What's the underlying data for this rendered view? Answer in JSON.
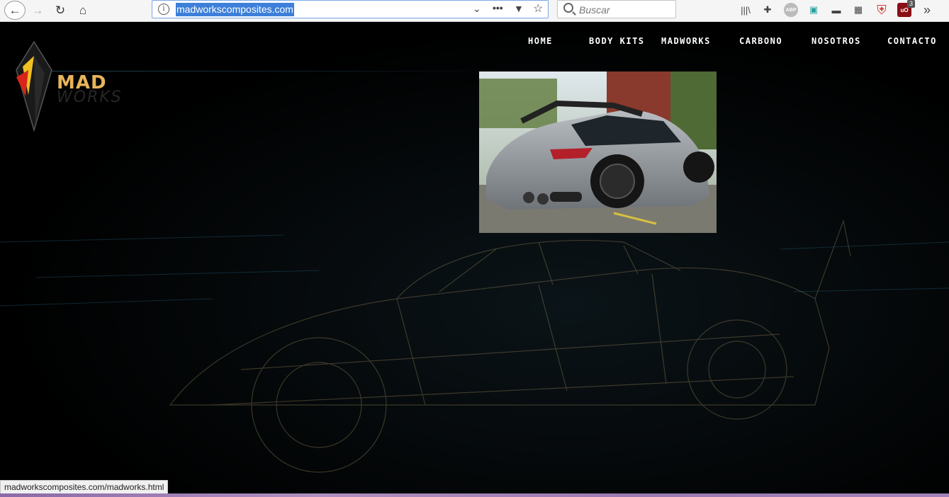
{
  "browser": {
    "url": "madworkscomposites.com",
    "search_placeholder": "Buscar",
    "page_actions_label": "•••",
    "tab_count_badge": "3"
  },
  "site": {
    "logo": {
      "top": "MAD",
      "bottom": "WORKS"
    },
    "nav": [
      "HOME",
      "BODY KITS",
      "MADWORKS",
      "CARBONO",
      "NOSOTROS",
      "CONTACTO"
    ]
  },
  "status": {
    "link_preview": "madworkscomposites.com/madworks.html"
  },
  "colors": {
    "accent_gold": "#e6b45a",
    "selection_blue": "#3d7fd9",
    "page_bg": "#000000"
  }
}
